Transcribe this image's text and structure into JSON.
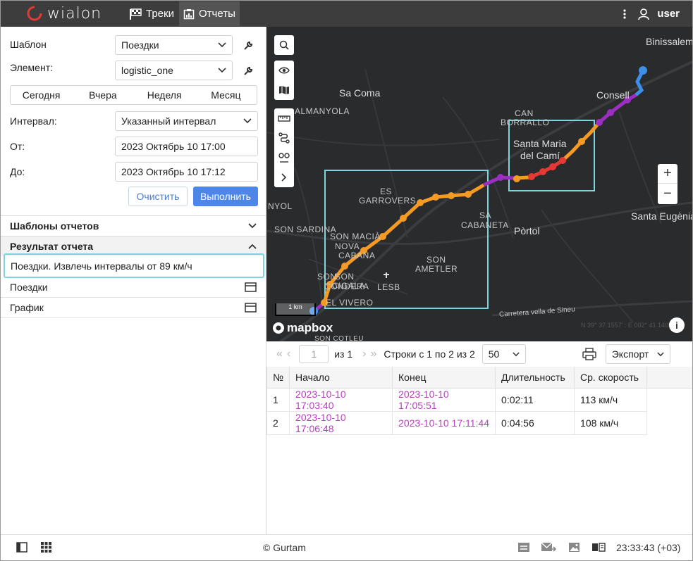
{
  "header": {
    "logo_text": "wialon",
    "tabs": [
      {
        "label": "Треки"
      },
      {
        "label": "Отчеты"
      }
    ],
    "user": "user"
  },
  "form": {
    "template_label": "Шаблон",
    "template_value": "Поездки",
    "element_label": "Элемент:",
    "element_value": "logistic_one",
    "periods": [
      "Сегодня",
      "Вчера",
      "Неделя",
      "Месяц"
    ],
    "interval_label": "Интервал:",
    "interval_value": "Указанный интервал",
    "from_label": "От:",
    "from_value": "2023 Октябрь 10 17:00",
    "to_label": "До:",
    "to_value": "2023 Октябрь 10 17:12",
    "clear_label": "Очистить",
    "run_label": "Выполнить"
  },
  "sections": {
    "templates": "Шаблоны отчетов",
    "result": "Результат отчета",
    "result_item": "Поездки. Извлечь интервалы от 89 км/ч",
    "sub_items": [
      "Поездки",
      "График"
    ]
  },
  "map": {
    "labels": [
      "Binissalem",
      "Sa Coma",
      "ALMANYOLA",
      "Consell",
      "CAN",
      "BORRALLO",
      "Santa Maria",
      "del Camí",
      "ES",
      "GARROVERS",
      "SA",
      "CABANETA",
      "Pòrtol",
      "Santa Eugènia",
      "SON MACIÀ",
      "NOVA",
      "CABANA",
      "SON",
      "AMETLER",
      "SON",
      "CIGALA",
      "SON",
      "CONDERA",
      "LESB",
      "EL VIVERO",
      "SON SARDINA",
      "NYOL",
      "Carretera vella de Sineu",
      "SON COTLEU"
    ],
    "scale_label": "1 km",
    "attribution": "mapbox",
    "coords": "N 39° 37.1557' : E 002° 41.1409'"
  },
  "table": {
    "page_value": "1",
    "of_pages": "из 1",
    "rows_info": "Строки с 1 по 2 из 2",
    "per_page": "50",
    "export_label": "Экспорт",
    "columns": [
      "№",
      "Начало",
      "Конец",
      "Длительность",
      "Ср. скорость"
    ],
    "rows": [
      [
        "1",
        "2023-10-10 17:03:40",
        "2023-10-10 17:05:51",
        "0:02:11",
        "113 км/ч"
      ],
      [
        "2",
        "2023-10-10 17:06:48",
        "2023-10-10 17:11:44",
        "0:04:56",
        "108 км/ч"
      ]
    ]
  },
  "footer": {
    "copyright": "© Gurtam",
    "clock": "23:33:43 (+03)"
  },
  "colors": {
    "header_bg": "#3d3d3d",
    "accent": "#4d86e6",
    "link": "#b43fbd",
    "track_orange": "#f59a23",
    "track_purple": "#9b2fc1",
    "track_red": "#e53935",
    "track_blue": "#3d8ee8",
    "highlight": "#7ed3dd"
  }
}
